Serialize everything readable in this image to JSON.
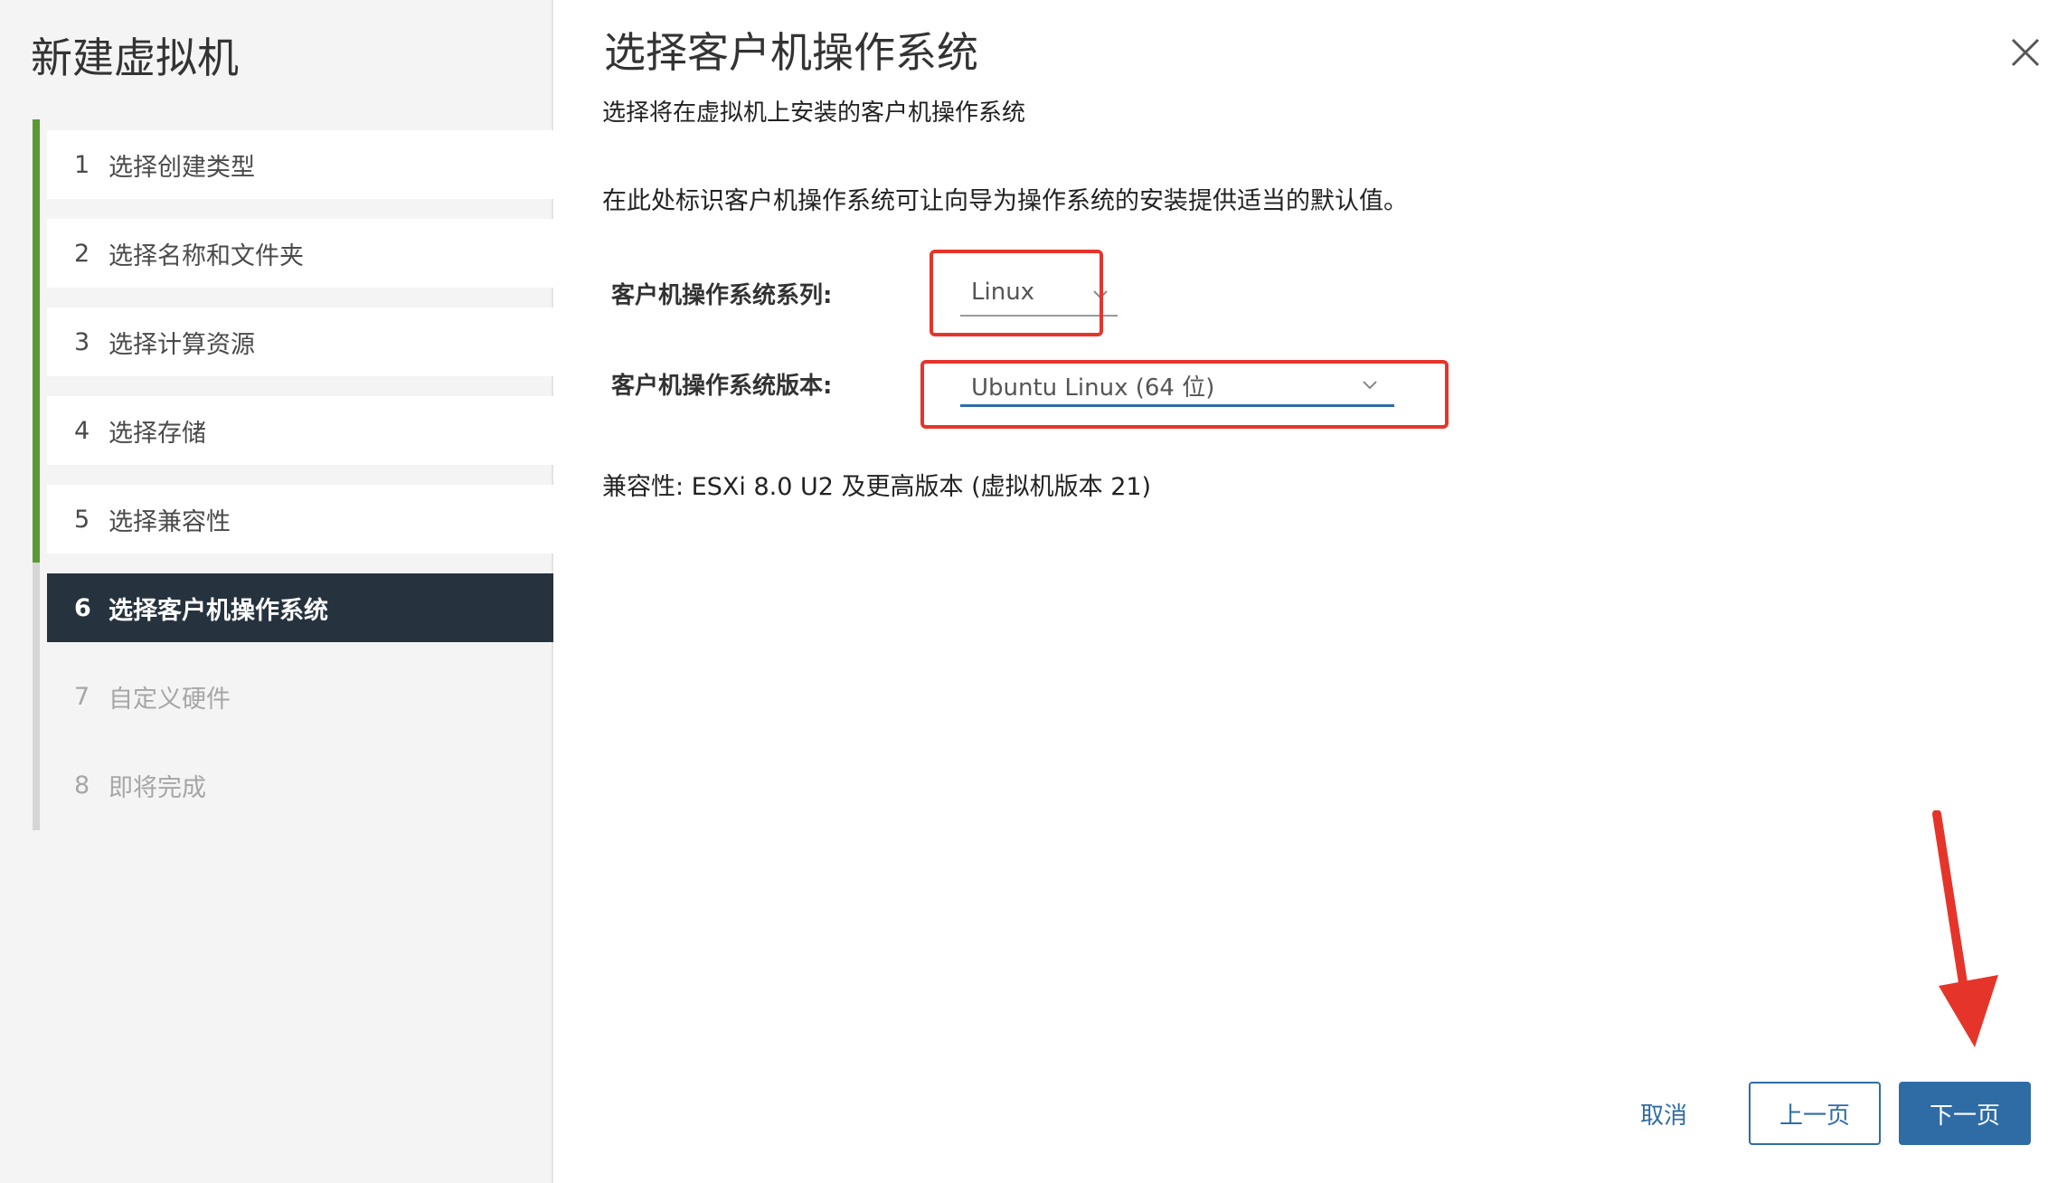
{
  "wizard": {
    "title": "新建虚拟机"
  },
  "steps": [
    {
      "num": "1",
      "label": "选择创建类型",
      "state": "done"
    },
    {
      "num": "2",
      "label": "选择名称和文件夹",
      "state": "done"
    },
    {
      "num": "3",
      "label": "选择计算资源",
      "state": "done"
    },
    {
      "num": "4",
      "label": "选择存储",
      "state": "done"
    },
    {
      "num": "5",
      "label": "选择兼容性",
      "state": "done"
    },
    {
      "num": "6",
      "label": "选择客户机操作系统",
      "state": "active"
    },
    {
      "num": "7",
      "label": "自定义硬件",
      "state": "pending"
    },
    {
      "num": "8",
      "label": "即将完成",
      "state": "pending"
    }
  ],
  "main": {
    "heading": "选择客户机操作系统",
    "subtitle": "选择将在虚拟机上安装的客户机操作系统",
    "description": "在此处标识客户机操作系统可让向导为操作系统的安装提供适当的默认值。",
    "family_label": "客户机操作系统系列:",
    "family_value": "Linux",
    "version_label": "客户机操作系统版本:",
    "version_value": "Ubuntu Linux (64 位)",
    "compatibility": "兼容性: ESXi 8.0 U2 及更高版本 (虚拟机版本 21)"
  },
  "footer": {
    "cancel_label": "取消",
    "back_label": "上一页",
    "next_label": "下一页"
  },
  "colors": {
    "accent": "#2f6ca6",
    "progress_done": "#5a9a32",
    "active_step_bg": "#26323d",
    "annotation_red": "#e5352b"
  },
  "icons": {
    "close": "close-icon",
    "dropdown": "chevron-down-icon",
    "annotation": "red-arrow-annotation"
  }
}
